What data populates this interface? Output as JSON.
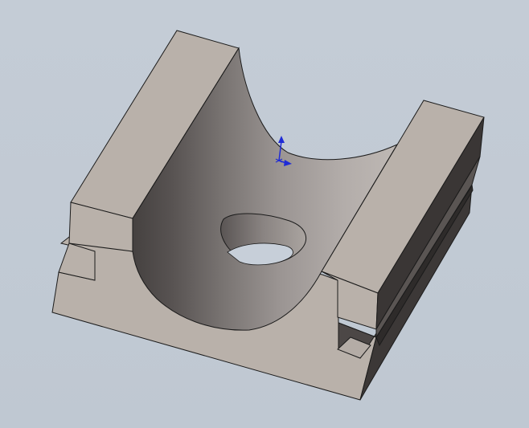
{
  "viewport": {
    "background": "#c1cad5",
    "model_name": "",
    "colors": {
      "face_light": "#b9b1aa",
      "face_mid": "#a59d97",
      "face_dark": "#55504e",
      "edge": "#1b1b1b",
      "triad": "#1f2bd6"
    }
  }
}
